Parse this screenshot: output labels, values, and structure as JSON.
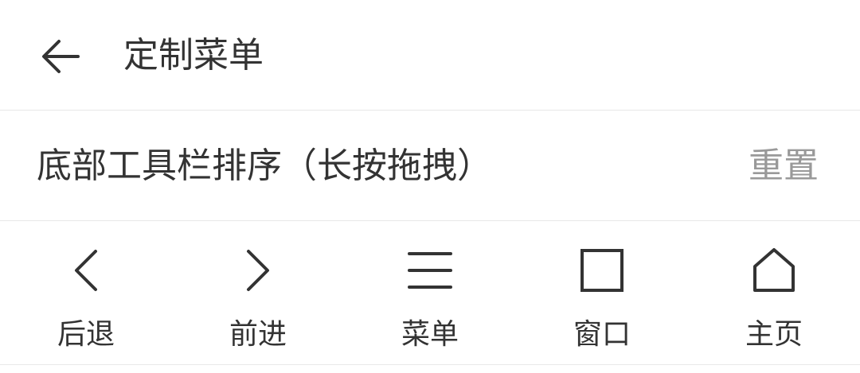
{
  "header": {
    "back_icon": "arrow-left-icon",
    "title": "定制菜单"
  },
  "section": {
    "title": "底部工具栏排序（长按拖拽）",
    "reset_label": "重置"
  },
  "toolbar": {
    "items": [
      {
        "label": "后退",
        "icon": "chevron-left-icon"
      },
      {
        "label": "前进",
        "icon": "chevron-right-icon"
      },
      {
        "label": "菜单",
        "icon": "menu-icon"
      },
      {
        "label": "窗口",
        "icon": "window-icon"
      },
      {
        "label": "主页",
        "icon": "home-icon"
      }
    ]
  },
  "colors": {
    "text": "#333333",
    "muted": "#999999",
    "divider": "#e8e8e8",
    "background": "#ffffff"
  }
}
